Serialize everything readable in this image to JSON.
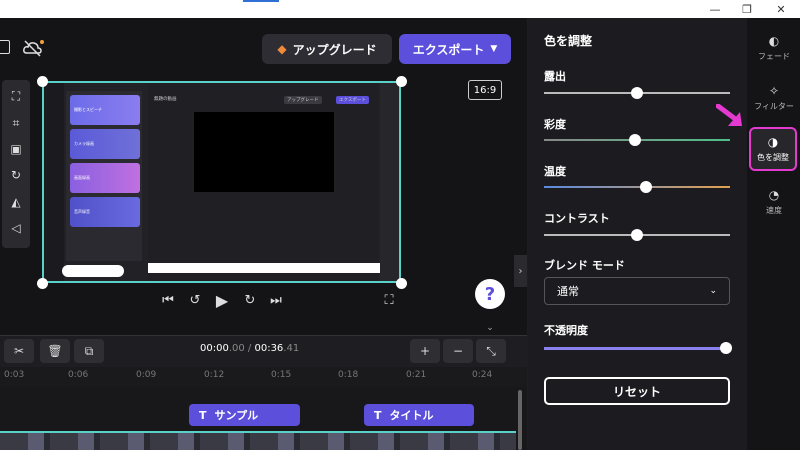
{
  "topbar": {
    "upgrade_label": "アップグレード",
    "export_label": "エクスポート"
  },
  "preview": {
    "ratio": "16:9",
    "inner": {
      "title": "無題の動画",
      "upgrade": "アップグレード",
      "export": "エクスポート",
      "cards": [
        "撮影とスピーチ",
        "カメラ録画",
        "画面録画",
        "音声録音"
      ]
    }
  },
  "timeline": {
    "time_current_main": "00:00",
    "time_current_frac": ".00",
    "time_sep": " / ",
    "time_total_main": "00:36",
    "time_total_frac": ".41",
    "ticks": [
      "0:03",
      "0:06",
      "0:09",
      "0:12",
      "0:15",
      "0:18",
      "0:21",
      "0:24"
    ],
    "clips": [
      {
        "label": "サンプル"
      },
      {
        "label": "タイトル"
      }
    ]
  },
  "panel": {
    "title": "色を調整",
    "sliders": [
      {
        "label": "露出",
        "value": 0.5
      },
      {
        "label": "彩度",
        "value": 0.49
      },
      {
        "label": "温度",
        "value": 0.55
      },
      {
        "label": "コントラスト",
        "value": 0.5
      }
    ],
    "blend_label": "ブレンド モード",
    "blend_value": "通常",
    "opacity_label": "不透明度",
    "opacity_value": 1.0,
    "reset_label": "リセット"
  },
  "rail": {
    "items": [
      {
        "label": "フェード",
        "icon": "fade-icon"
      },
      {
        "label": "フィルター",
        "icon": "filter-icon"
      },
      {
        "label": "色を調整",
        "icon": "color-adjust-icon"
      },
      {
        "label": "速度",
        "icon": "speed-icon"
      }
    ]
  },
  "colors": {
    "accent": "#5b4fdb",
    "selection": "#59d0c8",
    "highlight": "#e53ad0"
  }
}
